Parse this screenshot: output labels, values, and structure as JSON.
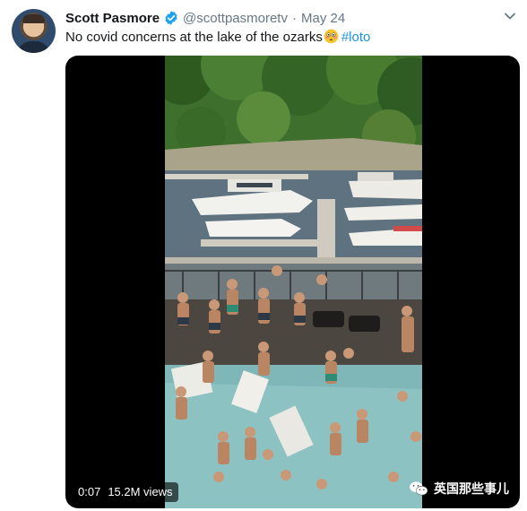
{
  "tweet": {
    "author_name": "Scott Pasmore",
    "handle": "@scottpasmoretv",
    "separator": "·",
    "date": "May 24",
    "text": "No covid concerns at the lake of the ozarks",
    "hashtag": "#loto"
  },
  "media": {
    "time": "0:07",
    "views": "15.2M views",
    "watermark": "英国那些事儿"
  },
  "colors": {
    "link": "#1b95e0",
    "secondary_text": "#657786",
    "verified": "#1da1f2"
  },
  "icons": [
    "verified-badge-icon",
    "flushed-face-emoji-icon",
    "chevron-down-icon",
    "wechat-icon"
  ]
}
